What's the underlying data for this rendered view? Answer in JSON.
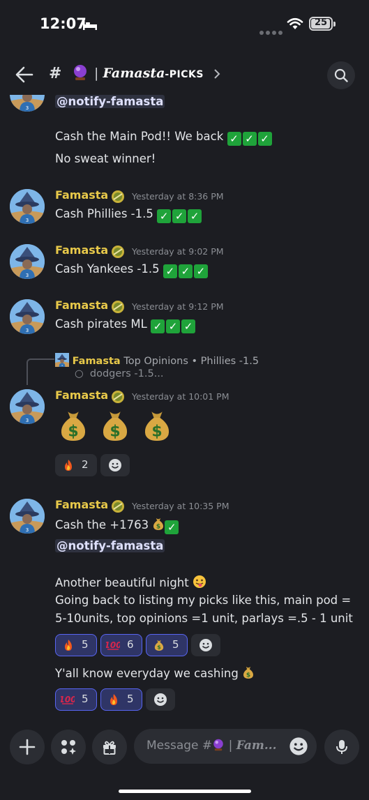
{
  "status": {
    "time": "12:07",
    "battery": "25"
  },
  "header": {
    "hash": "#",
    "sep": "|",
    "channel_name": "Famasta",
    "channel_suffix": "-PICKS",
    "chevron": "›"
  },
  "messages": [
    {
      "mention": "@notify-famasta",
      "line1": "Cash the Main Pod!! We back",
      "line2": "No sweat winner!"
    },
    {
      "author": "Famasta",
      "time": "Yesterday at 8:36 PM",
      "text": "Cash Phillies -1.5"
    },
    {
      "author": "Famasta",
      "time": "Yesterday at 9:02 PM",
      "text": "Cash Yankees -1.5"
    },
    {
      "author": "Famasta",
      "time": "Yesterday at 9:12 PM",
      "text": "Cash pirates ML"
    },
    {
      "reply": {
        "author": "Famasta",
        "channel": "Top Opinions",
        "bullet": "•",
        "text": "Phillies -1.5",
        "sub_bullet": "○",
        "sub_text": "dodgers -1.5..."
      },
      "author": "Famasta",
      "time": "Yesterday at 10:01 PM",
      "reactions": [
        {
          "icon": "fire-emoji",
          "count": "2",
          "active": false
        }
      ]
    },
    {
      "author": "Famasta",
      "time": "Yesterday at 10:35 PM",
      "line1": "Cash the +1763",
      "mention": "@notify-famasta",
      "line3": "Another beautiful night",
      "line4": "Going back to listing my picks like this, main pod =",
      "line5": "5-10units, top opinions =1 unit, parlays =.5 - 1 unit",
      "reactions": [
        {
          "icon": "fire-emoji",
          "count": "5",
          "active": true
        },
        {
          "icon": "hundred-emoji",
          "count": "6",
          "active": true
        },
        {
          "icon": "moneybag-emoji",
          "count": "5",
          "active": true
        }
      ],
      "line6": "Y'all know everyday we cashing",
      "reactions2": [
        {
          "icon": "hundred-emoji",
          "count": "5",
          "active": true
        },
        {
          "icon": "fire-emoji",
          "count": "5",
          "active": true
        }
      ]
    }
  ],
  "composer": {
    "placeholder_prefix": "Message #",
    "sep": "|",
    "placeholder_channel": "Fam..."
  },
  "colors": {
    "author": "#e8c94a",
    "accent": "#5865f2",
    "check": "#1fa33a",
    "background": "#1c1d22"
  }
}
